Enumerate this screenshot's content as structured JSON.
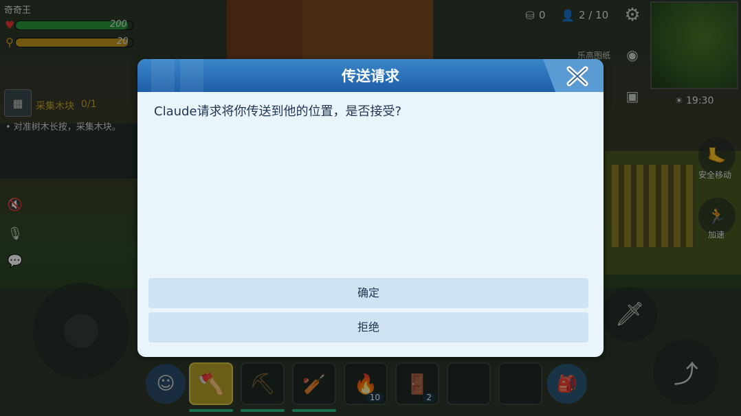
{
  "player": {
    "name": "奇奇王",
    "health": "200",
    "hunger": "20"
  },
  "top": {
    "coin_count": "0",
    "players": "2 / 10",
    "album_label": "乐高图纸",
    "time": "19:30"
  },
  "quest": {
    "title": "采集木块",
    "progress": "0/1",
    "hint": "• 对准树木长按，采集木块。"
  },
  "side": {
    "safe_move": "安全移动",
    "accelerate": "加速"
  },
  "hotbar": {
    "slots": [
      {
        "icon": "avatar-icon",
        "count": ""
      },
      {
        "icon": "axe-icon",
        "count": ""
      },
      {
        "icon": "pickaxe-icon",
        "count": ""
      },
      {
        "icon": "club-icon",
        "count": ""
      },
      {
        "icon": "torch-icon",
        "count": "10"
      },
      {
        "icon": "door-icon",
        "count": "2"
      },
      {
        "icon": "empty-slot",
        "count": ""
      },
      {
        "icon": "empty-slot",
        "count": ""
      },
      {
        "icon": "backpack-icon",
        "count": ""
      }
    ]
  },
  "dialog": {
    "title": "传送请求",
    "message": "Claude请求将你传送到他的位置，是否接受?",
    "confirm_label": "确定",
    "reject_label": "拒绝"
  },
  "colors": {
    "dialog_header": "#1e5ea8",
    "dialog_body": "#eaf4fb",
    "button_bg": "#cfe3f2",
    "health": "#2a9a3a",
    "hunger": "#c49a1e"
  }
}
